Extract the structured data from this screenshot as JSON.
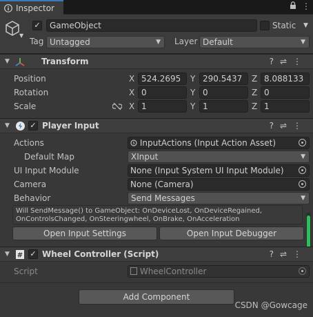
{
  "tab": {
    "label": "Inspector",
    "icon": "info-icon",
    "lock_icon": "lock-icon",
    "menu_icon": "kebab-menu-icon"
  },
  "gameobject": {
    "active_checked": true,
    "name": "GameObject",
    "static_label": "Static",
    "static_checked": false,
    "tag_label": "Tag",
    "tag_value": "Untagged",
    "layer_label": "Layer",
    "layer_value": "Default"
  },
  "transform": {
    "title": "Transform",
    "position": {
      "label": "Position",
      "x": "524.2695",
      "y": "290.5437",
      "z": "8.088133"
    },
    "rotation": {
      "label": "Rotation",
      "x": "0",
      "y": "0",
      "z": "0"
    },
    "scale": {
      "label": "Scale",
      "x": "1",
      "y": "1",
      "z": "1"
    },
    "axis_x": "X",
    "axis_y": "Y",
    "axis_z": "Z"
  },
  "player_input": {
    "title": "Player Input",
    "enabled": true,
    "actions_label": "Actions",
    "actions_value": "InputActions (Input Action Asset)",
    "default_map_label": "Default Map",
    "default_map_value": "XInput",
    "ui_module_label": "UI Input Module",
    "ui_module_value": "None (Input System UI Input Module)",
    "camera_label": "Camera",
    "camera_value": "None (Camera)",
    "behavior_label": "Behavior",
    "behavior_value": "Send Messages",
    "help_line1": "Will SendMessage() to GameObject: OnDeviceLost, OnDeviceRegained,",
    "help_line2": "OnControlsChanged, OnSteeringwheel, OnBrake, OnAcceleration",
    "open_settings": "Open Input Settings",
    "open_debugger": "Open Input Debugger"
  },
  "wheel_controller": {
    "title": "Wheel Controller (Script)",
    "enabled": true,
    "script_label": "Script",
    "script_value": "WheelController"
  },
  "add_component": "Add Component",
  "watermark": "CSDN @Gowcage",
  "colors": {
    "accent": "#3a79bb",
    "scroll_green": "#2dbd5a",
    "panel": "#383838"
  }
}
